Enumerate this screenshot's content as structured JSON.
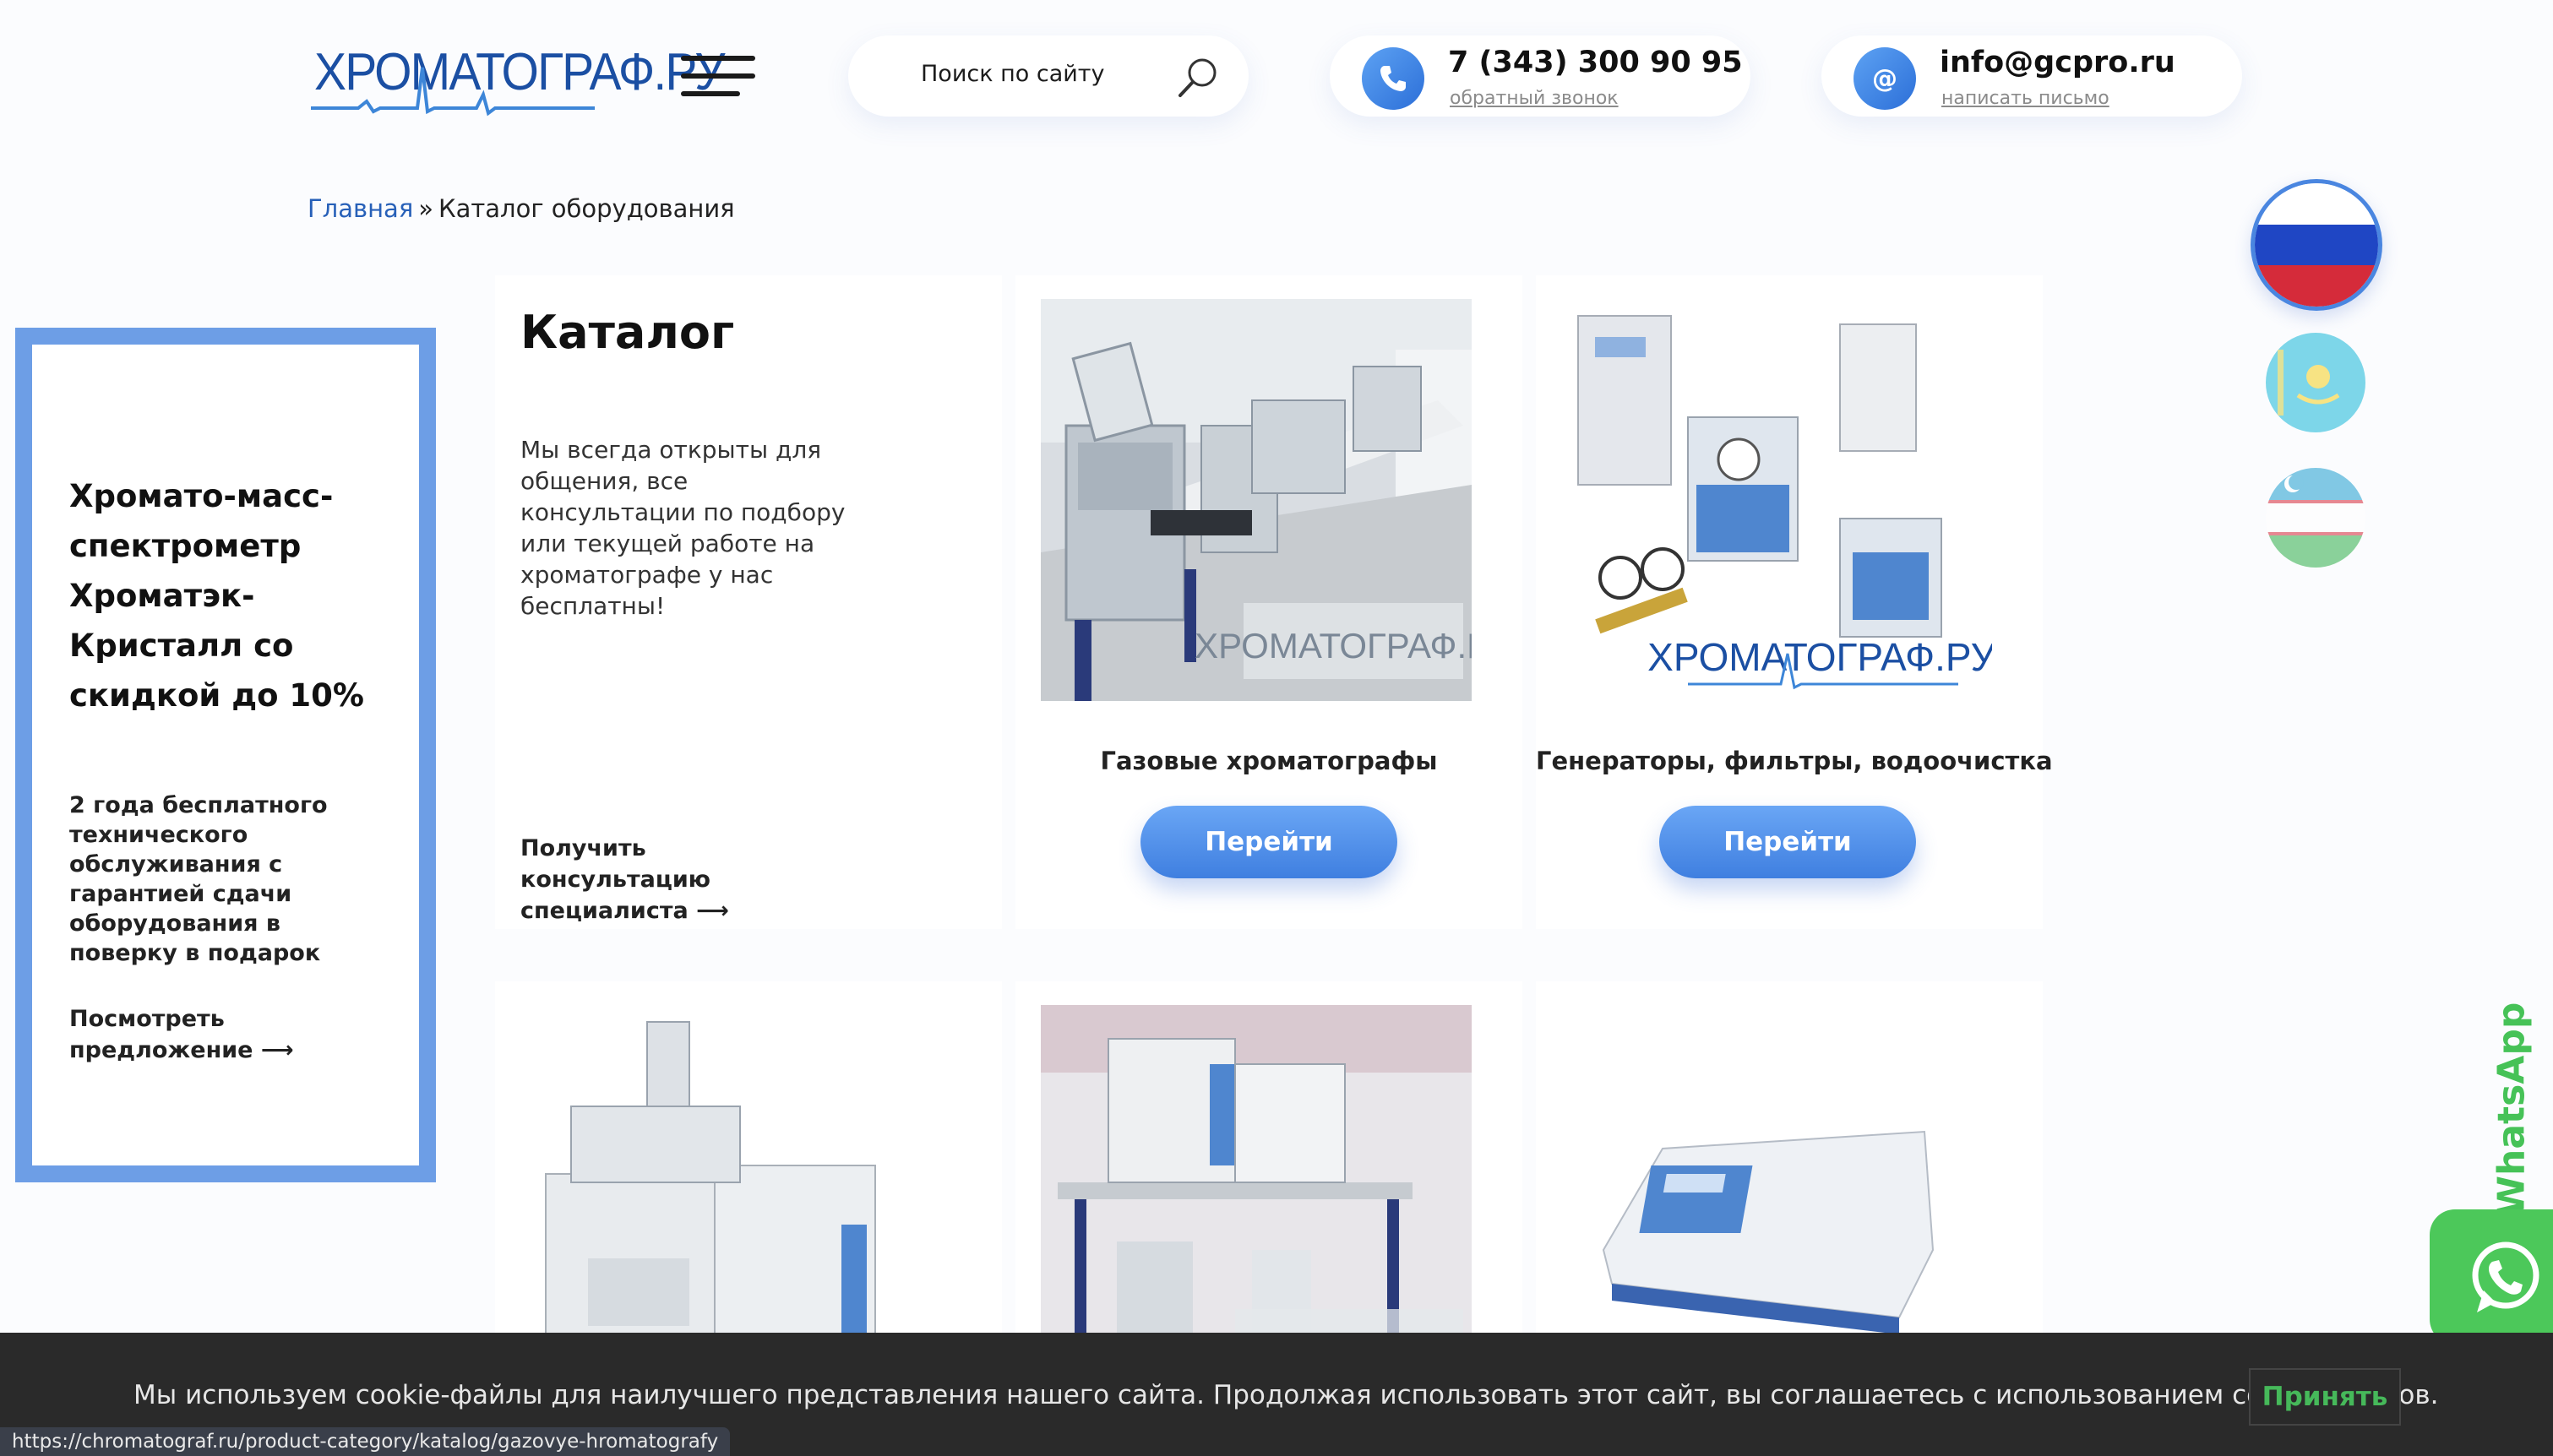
{
  "header": {
    "logo_text": "ХРОМАТОГРАФ.РУ",
    "search_placeholder": "Поиск по сайту",
    "phone": "7 (343) 300 90 95",
    "phone_sub": "обратный звонок",
    "email": "info@gcpro.ru",
    "email_sub": "написать письмо"
  },
  "breadcrumb": {
    "home": "Главная",
    "separator": "»",
    "current": "Каталог оборудования"
  },
  "flags": [
    "russia-flag",
    "kazakhstan-flag",
    "uzbekistan-flag"
  ],
  "promo": {
    "title": "Хромато-масс-спектрометр Хроматэк-Кристалл со скидкой до 10%",
    "text": "2 года бесплатного технического обслуживания с гарантией сдачи оборудования в поверку в подарок",
    "link": "Посмотреть предложение ⟶"
  },
  "intro": {
    "title": "Каталог",
    "text": "Мы всегда открыты для общения, все консультации по подбору или текущей работе на хроматографе у нас бесплатны!",
    "link": "Получить консультацию специалиста ⟶"
  },
  "categories": [
    {
      "title": "Газовые хроматографы",
      "button": "Перейти"
    },
    {
      "title": "Генераторы, фильтры, водоочистка",
      "button": "Перейти"
    }
  ],
  "watermark": "ХРОМАТОГРАФ.РУ",
  "whatsapp": {
    "label": "WhatsApp"
  },
  "cookie": {
    "text": "Мы используем cookie-файлы для наилучшего представления нашего сайта. Продолжая использовать этот сайт, вы соглашаетесь с использованием cookie-файлов.",
    "accept": "Принять"
  },
  "status_url": "https://chromatograf.ru/product-category/katalog/gazovye-hromatografy",
  "colors": {
    "accent": "#4a86e0",
    "promo_border": "#6d9ee6",
    "whatsapp": "#4cc85a",
    "cookie_bg": "#2a2a2a"
  }
}
